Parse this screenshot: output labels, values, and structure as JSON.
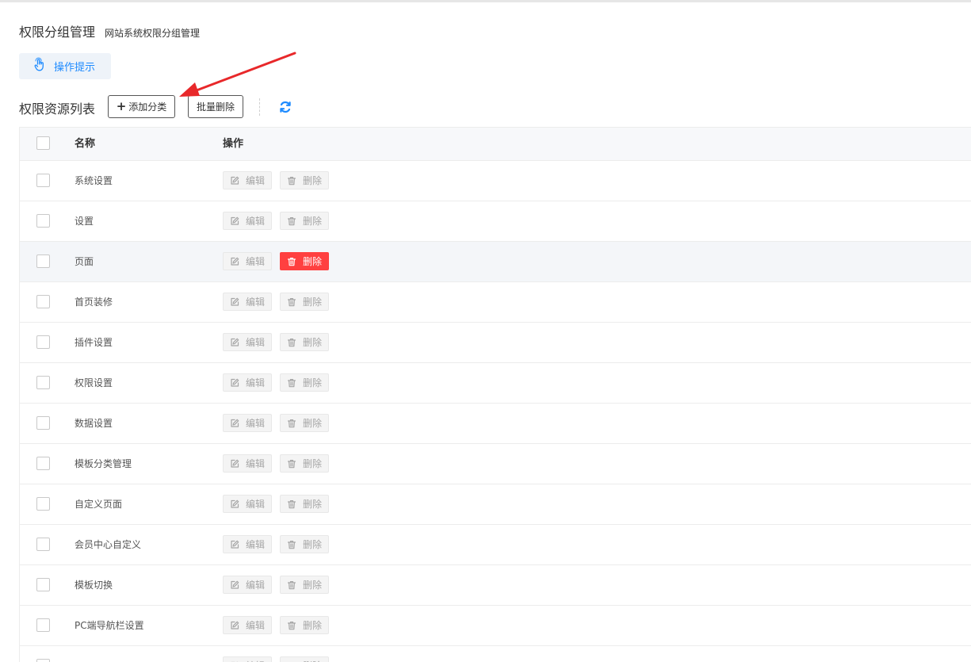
{
  "header": {
    "title": "权限分组管理",
    "subtitle": "网站系统权限分组管理"
  },
  "hint": {
    "label": "操作提示",
    "icon": "hand-pointer-icon"
  },
  "toolbar": {
    "list_title": "权限资源列表",
    "add_label": "添加分类",
    "batch_delete_label": "批量删除",
    "refresh_icon": "refresh-icon"
  },
  "table": {
    "columns": [
      "名称",
      "操作"
    ],
    "edit_label": "编辑",
    "delete_label": "删除",
    "rows": [
      {
        "name": "系统设置"
      },
      {
        "name": "设置"
      },
      {
        "name": "页面"
      },
      {
        "name": "首页装修"
      },
      {
        "name": "插件设置"
      },
      {
        "name": "权限设置"
      },
      {
        "name": "数据设置"
      },
      {
        "name": "模板分类管理"
      },
      {
        "name": "自定义页面"
      },
      {
        "name": "会员中心自定义"
      },
      {
        "name": "模板切换"
      },
      {
        "name": "PC端导航栏设置"
      },
      {
        "name": ""
      }
    ]
  },
  "colors": {
    "accent": "#1e8bff",
    "danger": "#ff4040",
    "annotation_arrow": "#e8282a"
  }
}
